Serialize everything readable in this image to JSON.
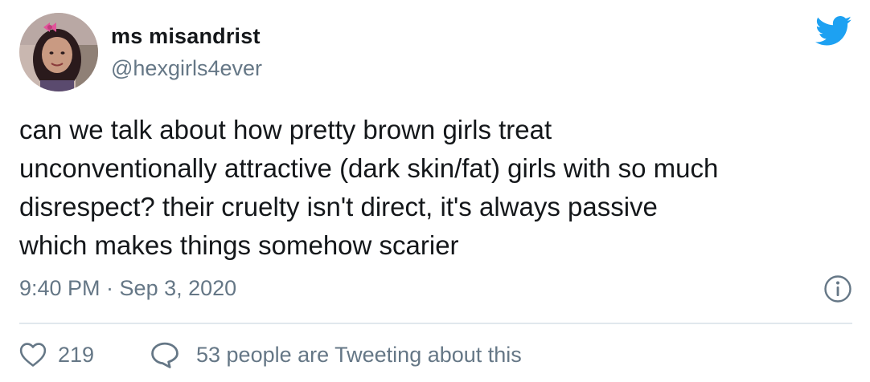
{
  "author": {
    "display_name": "ms misandrist",
    "handle": "@hexgirls4ever",
    "avatar_icon": "profile-photo"
  },
  "brand": {
    "icon": "twitter-bird-icon",
    "color": "#1da1f2"
  },
  "tweet": {
    "lines": [
      "can we talk about how pretty brown girls treat",
      "unconventionally attractive (dark skin/fat) girls with so much",
      "disrespect? their cruelty isn't direct, it's always passive",
      "which makes things somehow scarier"
    ],
    "timestamp": "9:40 PM · Sep 3, 2020"
  },
  "actions": {
    "likes_count": "219",
    "like_icon": "heart-icon",
    "conversation_icon": "speech-bubble-icon",
    "conversation_text": "53 people are Tweeting about this"
  },
  "info_icon": "info-icon",
  "colors": {
    "text": "#14171a",
    "secondary": "#657786",
    "divider": "#e1e8ed"
  }
}
